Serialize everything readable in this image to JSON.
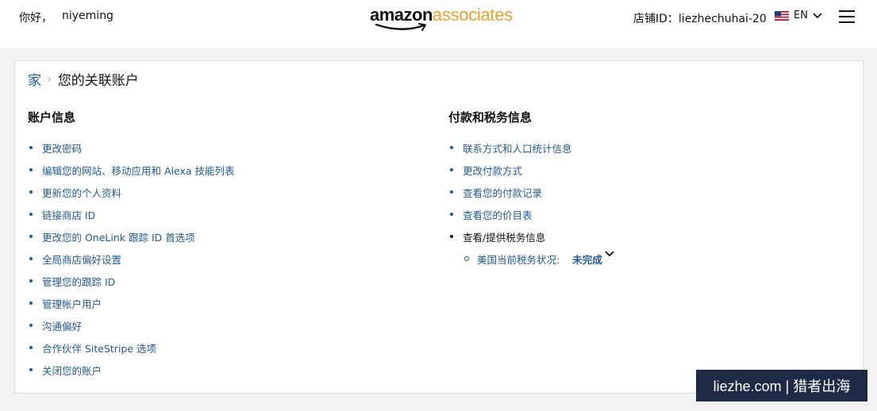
{
  "header": {
    "greeting": "你好，",
    "username": "niyeming",
    "logo": {
      "amazon": "amazon",
      "associates": "associates"
    },
    "store_id": "店铺ID：liezhechuhai-20",
    "language": "EN",
    "icons": {
      "flag": "us-flag-icon",
      "lang_chevron": "chevron-down-icon",
      "menu": "hamburger-menu-icon"
    }
  },
  "breadcrumb": {
    "home": "家",
    "separator": "›",
    "current": "您的关联账户"
  },
  "account_info": {
    "title": "账户信息",
    "items": [
      "更改密码",
      "编辑您的网站、移动应用和 Alexa 技能列表",
      "更新您的个人资料",
      "链接商店 ID",
      "更改您的 OneLink 跟踪 ID 首选项",
      "全局商店偏好设置",
      "管理您的跟踪 ID",
      "管理帐户用户",
      "沟通偏好",
      "合作伙伴 SiteStripe 选项",
      "关闭您的账户"
    ]
  },
  "payment_tax": {
    "title": "付款和税务信息",
    "items": [
      "联系方式和人口统计信息",
      "更改付款方式",
      "查看您的付款记录",
      "查看您的价目表"
    ],
    "tax_item": "查看/提供税务信息",
    "tax_status_label": "美国当前税务状况:",
    "tax_status_value": "未完成"
  },
  "watermark": "liezhe.com | 猎者出海",
  "colors": {
    "link": "#1f5a92",
    "logo_orange": "#f0a02a",
    "background": "#f2f2f2",
    "watermark_bg": "#1e2a46"
  }
}
